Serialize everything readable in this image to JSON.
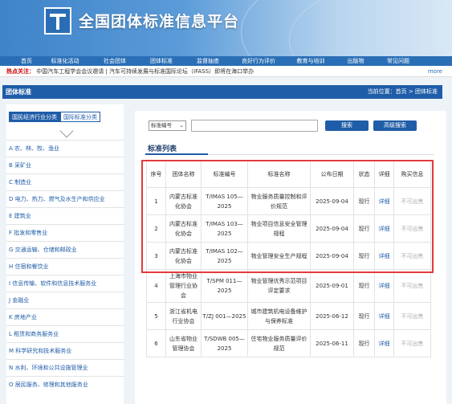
{
  "site": {
    "title": "全国团体标准信息平台"
  },
  "nav": [
    "首页",
    "标准化活动",
    "社会团体",
    "团体标准",
    "监督抽查",
    "良好行为评价",
    "教育与培训",
    "出版物",
    "常见问题"
  ],
  "hot": {
    "label": "热点关注：",
    "text": "中国汽车工程学会会议邀请 | 汽车可持续发展与标准国际论坛（IFASS）即将在海口举办",
    "more": "more"
  },
  "section": {
    "title": "团体标准",
    "breadcrumb": "当前位置：首页 > 团体标准"
  },
  "sidebar": {
    "tabs": [
      "国民经济行业分类",
      "国际标准分类"
    ],
    "items": [
      "A 农、林、牧、渔业",
      "B 采矿业",
      "C 制造业",
      "D 电力、热力、燃气及水生产和供应业",
      "E 建筑业",
      "F 批发和零售业",
      "G 交通运输、仓储和邮政业",
      "H 住宿和餐饮业",
      "I 信息传输、软件和信息技术服务业",
      "J 金融业",
      "K 房地产业",
      "L 租赁和商务服务业",
      "M 科学研究和技术服务业",
      "N 水利、环境和公共设施管理业",
      "O 居民服务、修理和其他服务业"
    ]
  },
  "search": {
    "select": "标准编号",
    "search_label": "搜索",
    "advanced_label": "高级搜索"
  },
  "list": {
    "title": "标准列表",
    "headers": [
      "序号",
      "团体名称",
      "标准编号",
      "标准名称",
      "公布日期",
      "状态",
      "详细",
      "购买信息"
    ],
    "rows": [
      [
        "1",
        "内蒙古标准化协会",
        "T/IMAS 105—2025",
        "物业服务质量控制和评价规范",
        "2025-09-04",
        "现行",
        "详细",
        "不可出售"
      ],
      [
        "2",
        "内蒙古标准化协会",
        "T/IMAS 103—2025",
        "物业项目信息安全管理规程",
        "2025-09-04",
        "现行",
        "详细",
        "不可出售"
      ],
      [
        "3",
        "内蒙古标准化协会",
        "T/IMAS 102—2025",
        "物业管理安全生产规程",
        "2025-09-04",
        "现行",
        "详细",
        "不可出售"
      ],
      [
        "4",
        "上海市物业管理行业协会",
        "T/SPM 011—2025",
        "物业管理优秀示范项目评定要求",
        "2025-09-01",
        "现行",
        "详细",
        "不可出售"
      ],
      [
        "5",
        "浙江省机电行业协会",
        "T/ZJ 001—2025",
        "城市建筑机电设备维护与保养标准",
        "2025-06-12",
        "现行",
        "详细",
        "不可出售"
      ],
      [
        "6",
        "山东省物业管理协会",
        "T/SDWB 005—2025",
        "住宅物业服务质量评价规范",
        "2025-06-11",
        "现行",
        "详细",
        "不可出售"
      ]
    ]
  },
  "colors": {
    "nav": "#2a6fb6",
    "section": "#1f5da8",
    "highlight": "#e23b3b"
  }
}
